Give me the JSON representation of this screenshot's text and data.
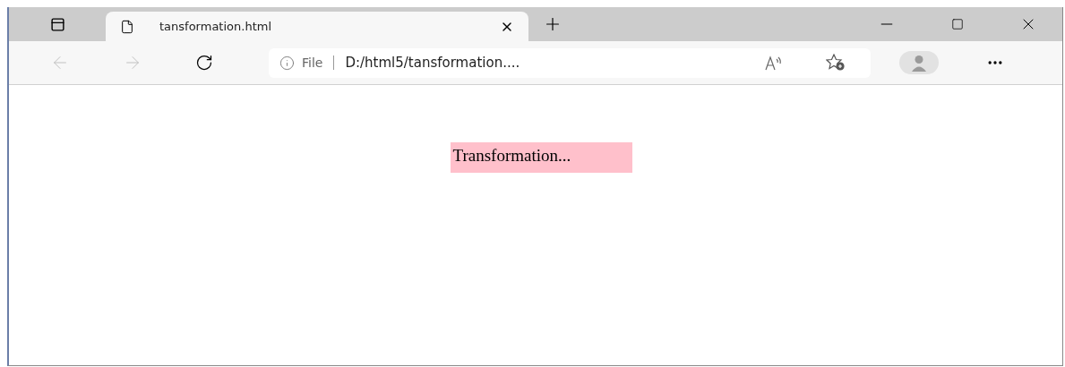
{
  "tabs": [
    {
      "title": "tansformation.html",
      "selected": true
    }
  ],
  "address_bar": {
    "scheme_label": "File",
    "url": "D:/html5/tansformation...."
  },
  "page": {
    "text": "Transformation..."
  }
}
